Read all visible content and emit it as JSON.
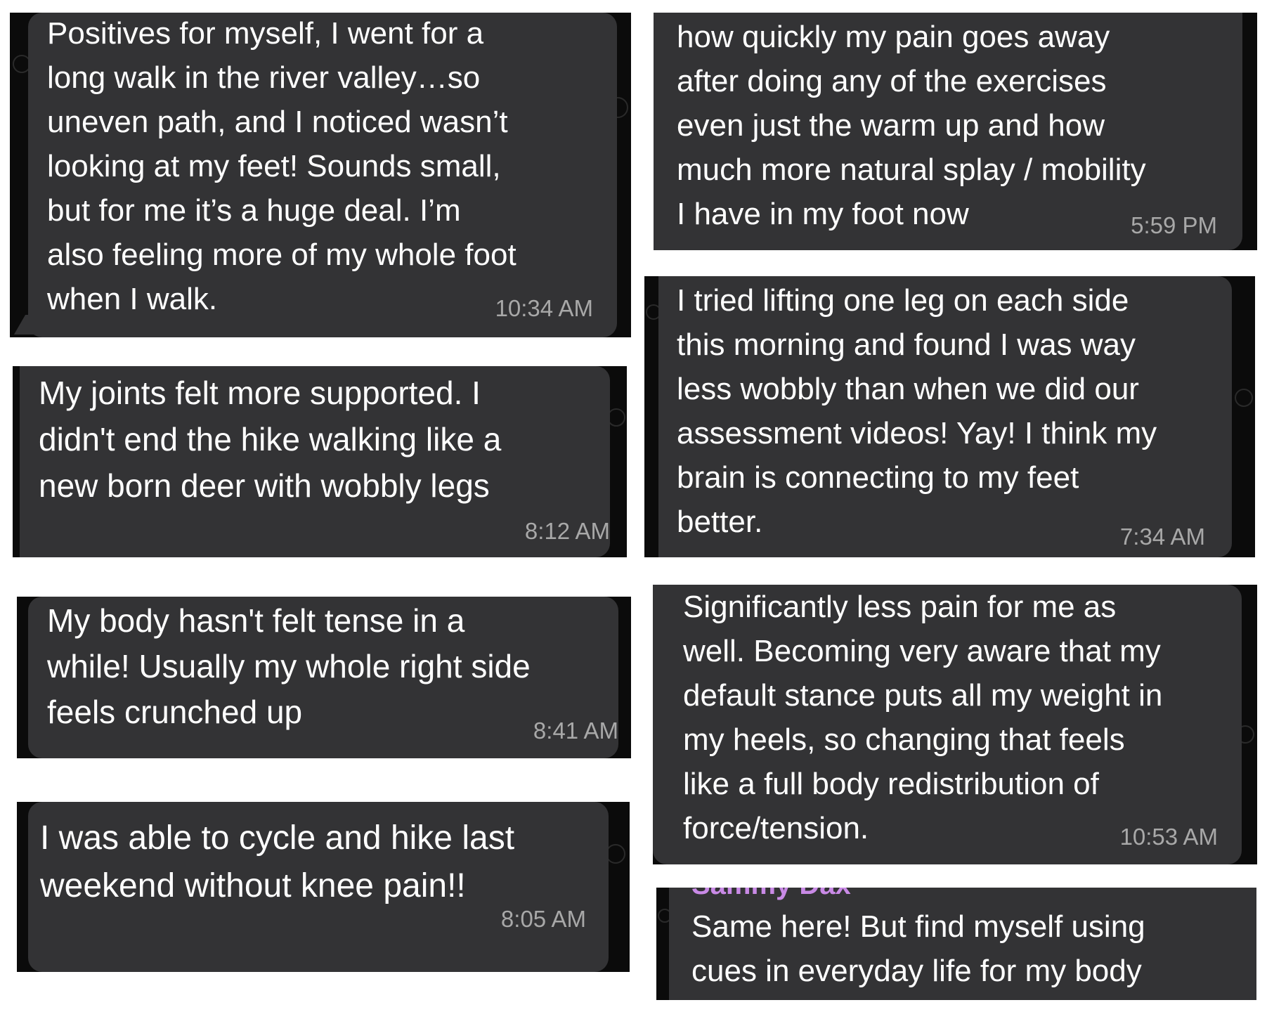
{
  "messages": [
    {
      "text": "Positives for myself, I went for a\nlong walk in the river valley…so\nuneven path, and I noticed wasn’t\nlooking at my feet! Sounds small,\nbut for me it’s a huge deal.   I’m\nalso feeling more of my whole foot\nwhen I walk.",
      "time": "10:34 AM"
    },
    {
      "text": "how quickly my pain goes away\nafter doing any of the exercises\neven just the warm up and how\nmuch more natural splay / mobility\nI have in my foot now",
      "time": "5:59 PM"
    },
    {
      "text": "My joints felt more supported. I\ndidn't end the hike walking like a\nnew born deer with wobbly legs",
      "time": "8:12 AM"
    },
    {
      "text": "I tried lifting one leg on each side\nthis morning and found I was way\nless wobbly than when we did our\nassessment videos! Yay! I think my\nbrain is connecting to my feet\nbetter.",
      "time": "7:34 AM"
    },
    {
      "text": "My body hasn't felt tense in a\nwhile! Usually my whole right side\nfeels crunched up",
      "time": "8:41 AM"
    },
    {
      "text": "Significantly less pain for me as\nwell. Becoming very aware that my\ndefault stance puts all my weight in\nmy heels, so changing that feels\nlike a full body redistribution of\nforce/tension.",
      "time": "10:53 AM"
    },
    {
      "text": "I was able to cycle and hike last\nweekend without knee pain!!",
      "time": "8:05 AM"
    },
    {
      "sender": "Sammy Dax",
      "text": "Same here! But find myself using\ncues in everyday life for my body"
    }
  ],
  "colors": {
    "bubble": "#333335",
    "background": "#0b0b0b",
    "text": "#ffffff",
    "timestamp": "#a8a8a8",
    "sender": "#c98ae6"
  }
}
